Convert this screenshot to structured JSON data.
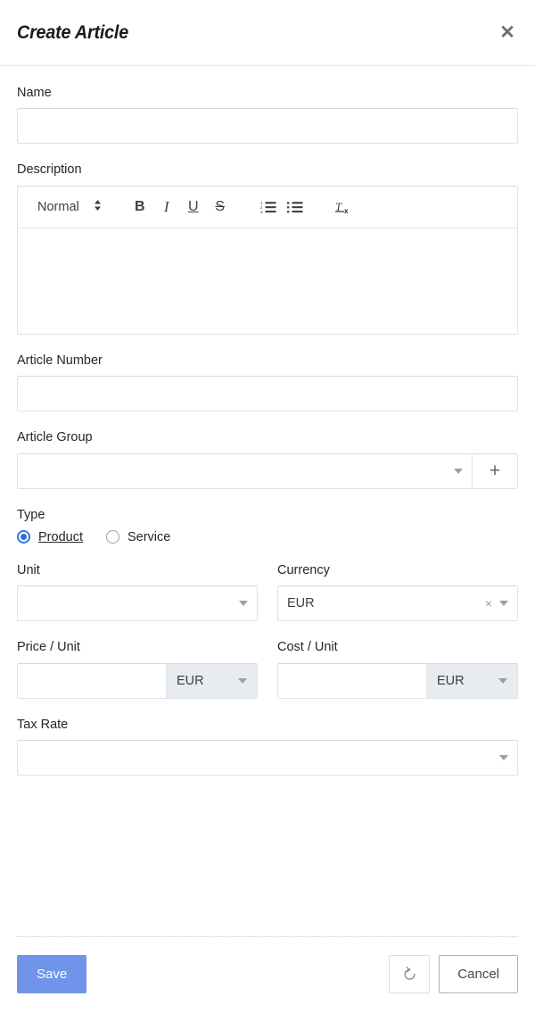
{
  "header": {
    "title": "Create Article",
    "close_icon": "close-icon"
  },
  "form": {
    "name": {
      "label": "Name",
      "value": "",
      "placeholder": ""
    },
    "description": {
      "label": "Description",
      "value": "",
      "toolbar": {
        "format_label": "Normal",
        "format_picker_icon": "updown-chevron-icon",
        "bold_label": "B",
        "italic_label": "I",
        "underline_label": "U",
        "strike_label": "S",
        "ordered_list_icon": "ordered-list-icon",
        "bullet_list_icon": "bullet-list-icon",
        "clear_format_label": "Tx"
      }
    },
    "article_number": {
      "label": "Article Number",
      "value": "",
      "placeholder": ""
    },
    "article_group": {
      "label": "Article Group",
      "value": "",
      "add_label": "+"
    },
    "type": {
      "label": "Type",
      "options": [
        {
          "label": "Product",
          "selected": true,
          "focused": true
        },
        {
          "label": "Service",
          "selected": false,
          "focused": false
        }
      ]
    },
    "unit": {
      "label": "Unit",
      "value": ""
    },
    "currency": {
      "label": "Currency",
      "value": "EUR",
      "clear_label": "×"
    },
    "price_per_unit": {
      "label": "Price / Unit",
      "value": "",
      "currency": "EUR"
    },
    "cost_per_unit": {
      "label": "Cost / Unit",
      "value": "",
      "currency": "EUR"
    },
    "tax_rate": {
      "label": "Tax Rate",
      "value": ""
    }
  },
  "footer": {
    "save_label": "Save",
    "reset_icon": "undo-icon",
    "cancel_label": "Cancel"
  },
  "colors": {
    "accent": "#6f94ea",
    "radio_selected": "#2b6ddb",
    "border": "#dfe3ea",
    "addon_bg": "#e8ebef"
  }
}
